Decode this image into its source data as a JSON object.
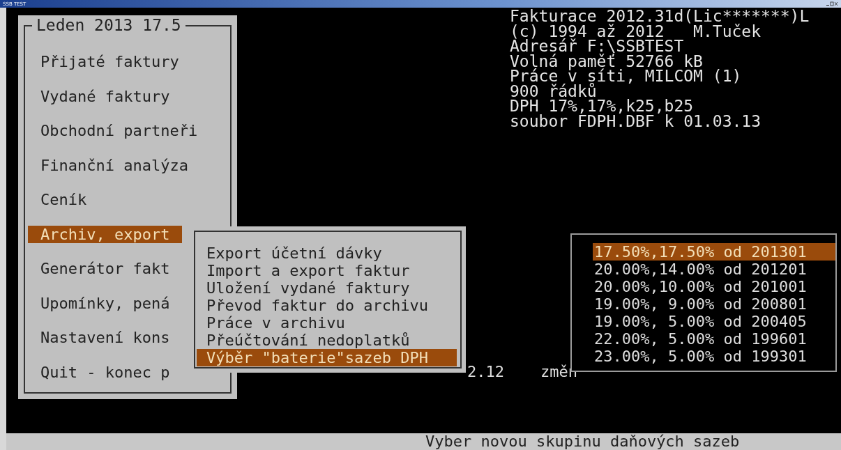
{
  "window": {
    "title": "SSB TEST"
  },
  "main_menu": {
    "title": "Leden 2013 17.5",
    "items": [
      {
        "label": "Přijaté faktury",
        "selected": false
      },
      {
        "label": "Vydané faktury",
        "selected": false
      },
      {
        "label": "Obchodní partneři",
        "selected": false
      },
      {
        "label": "Finanční analýza",
        "selected": false
      },
      {
        "label": "Ceník",
        "selected": false
      },
      {
        "label": "Archiv, export",
        "selected": true
      },
      {
        "label": "Generátor fakt",
        "selected": false
      },
      {
        "label": "Upomínky, pená",
        "selected": false
      },
      {
        "label": "Nastavení kons",
        "selected": false
      },
      {
        "label": "Quit - konec p",
        "selected": false
      }
    ]
  },
  "info_lines": [
    "Fakturace 2012.31d(Lic*******)L",
    "(c) 1994 až 2012   M.Tuček",
    "Adresář F:\\SSBTEST",
    "Volná paměť 52766 kB",
    "Práce v síti, MILCOM (1)",
    "900 řádků",
    "DPH 17%,17%,k25,b25",
    "soubor FDPH.DBF k 01.03.13"
  ],
  "submenu": {
    "items": [
      {
        "label": "Export účetní dávky",
        "selected": false
      },
      {
        "label": "Import a export faktur",
        "selected": false
      },
      {
        "label": "Uložení vydané faktury",
        "selected": false
      },
      {
        "label": "Převod faktur do archivu",
        "selected": false
      },
      {
        "label": "Práce v archivu",
        "selected": false
      },
      {
        "label": "Přeúčtování nedoplatků",
        "selected": false
      },
      {
        "label": "Výběr \"baterie\"sazeb DPH",
        "selected": true
      }
    ]
  },
  "background_text": [
    "2.12",
    "změn"
  ],
  "rates": {
    "items": [
      {
        "label": "17.50%,17.50% od 201301",
        "selected": true
      },
      {
        "label": "20.00%,14.00% od 201201",
        "selected": false
      },
      {
        "label": "20.00%,10.00% od 201001",
        "selected": false
      },
      {
        "label": "19.00%, 9.00% od 200801",
        "selected": false
      },
      {
        "label": "19.00%, 5.00% od 200405",
        "selected": false
      },
      {
        "label": "22.00%, 5.00% od 199601",
        "selected": false
      },
      {
        "label": "23.00%, 5.00% od 199301",
        "selected": false
      }
    ]
  },
  "status_bar": "Vyber novou skupinu daňových sazeb"
}
